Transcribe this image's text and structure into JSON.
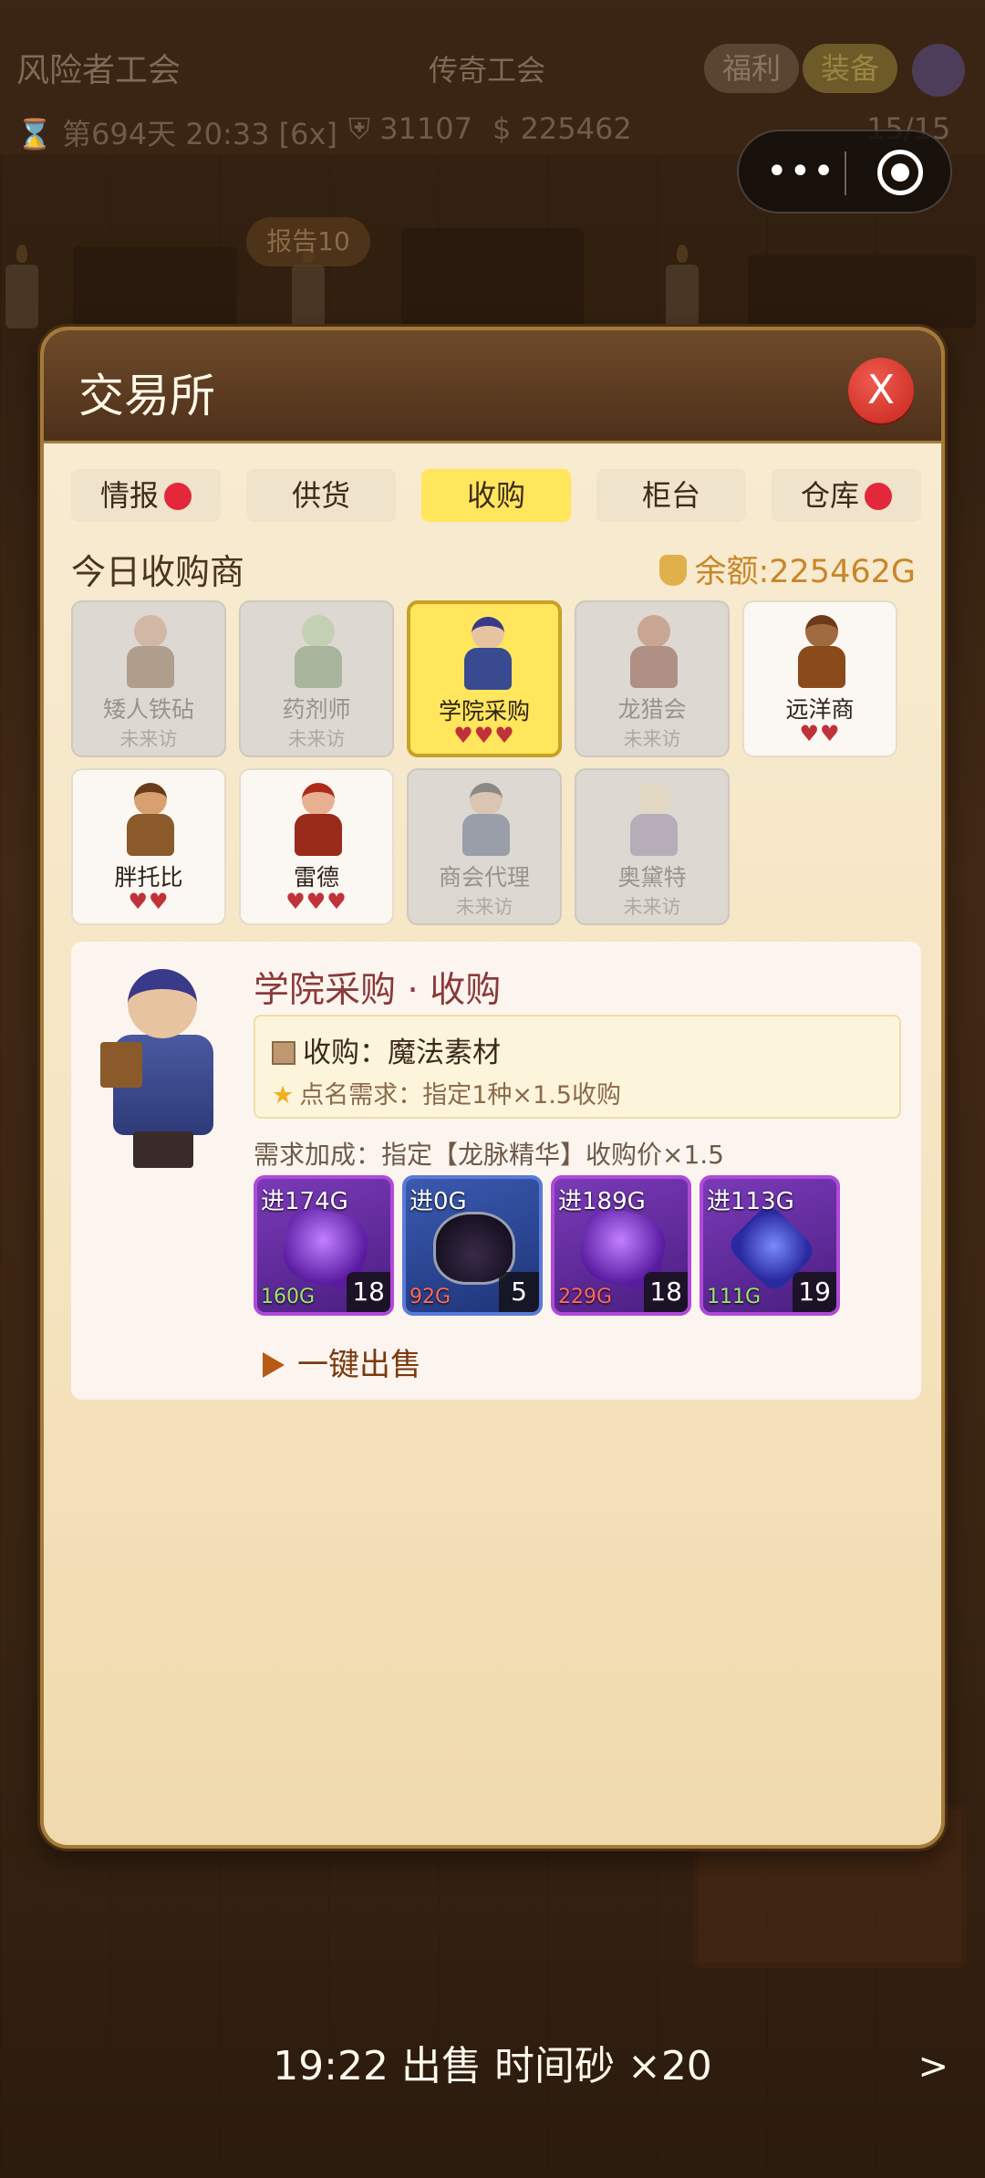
{
  "topbar": {
    "guild_name": "风险者工会",
    "guild_rank": "传奇工会",
    "welfare_btn": "福利",
    "equip_btn": "装备",
    "day_time": "⌛ 第694天 20:33 [6x]",
    "shield_value": "31107",
    "gold_value": "225462",
    "slots": "15/15",
    "report_tag": "报告10"
  },
  "capsule": {
    "menu": "•••",
    "close_icon": "record-icon"
  },
  "modal": {
    "title": "交易所",
    "close_label": "X",
    "tabs": [
      {
        "label": "情报",
        "badge": true
      },
      {
        "label": "供货",
        "badge": false
      },
      {
        "label": "收购",
        "badge": false,
        "active": true
      },
      {
        "label": "柜台",
        "badge": false
      },
      {
        "label": "仓库",
        "badge": true
      }
    ],
    "section_title": "今日收购商",
    "balance": "余额:225462G",
    "merchants": [
      {
        "name": "矮人铁砧",
        "status": "未来访",
        "hearts": ""
      },
      {
        "name": "药剂师",
        "status": "未来访",
        "hearts": ""
      },
      {
        "name": "学院采购",
        "status": "",
        "hearts": "♥♥♥"
      },
      {
        "name": "龙猎会",
        "status": "未来访",
        "hearts": ""
      },
      {
        "name": "远洋商",
        "status": "",
        "hearts": "♥♥"
      },
      {
        "name": "胖托比",
        "status": "",
        "hearts": "♥♥"
      },
      {
        "name": "雷德",
        "status": "",
        "hearts": "♥♥♥"
      },
      {
        "name": "商会代理",
        "status": "未来访",
        "hearts": ""
      },
      {
        "name": "奥黛特",
        "status": "未来访",
        "hearts": ""
      }
    ],
    "detail": {
      "title": "学院采购 · 收购",
      "need": "收购：魔法素材",
      "named_need": "点名需求：指定1种×1.5收购",
      "bonus": "需求加成：指定【龙脉精华】收购价×1.5",
      "items": [
        {
          "buy": "进174G",
          "price": "160G",
          "qty": "18",
          "trend": "up",
          "style": "purple",
          "icon": "crystal"
        },
        {
          "buy": "进0G",
          "price": "92G",
          "qty": "5",
          "trend": "down",
          "style": "blue",
          "icon": "potion"
        },
        {
          "buy": "进189G",
          "price": "229G",
          "qty": "18",
          "trend": "down",
          "style": "purple",
          "icon": "crystal"
        },
        {
          "buy": "进113G",
          "price": "111G",
          "qty": "19",
          "trend": "up",
          "style": "purple",
          "icon": "orb"
        }
      ],
      "sell_all": "一键出售"
    }
  },
  "ticker": {
    "message": "19:22 出售 时间砂 ×20",
    "next": ">"
  },
  "colors": {
    "accent_yellow": "#ffe65c",
    "title_red": "#8a3a3a",
    "heart": "#c0323a",
    "badge_red": "#e2283a",
    "gold_text": "#c8862a"
  }
}
